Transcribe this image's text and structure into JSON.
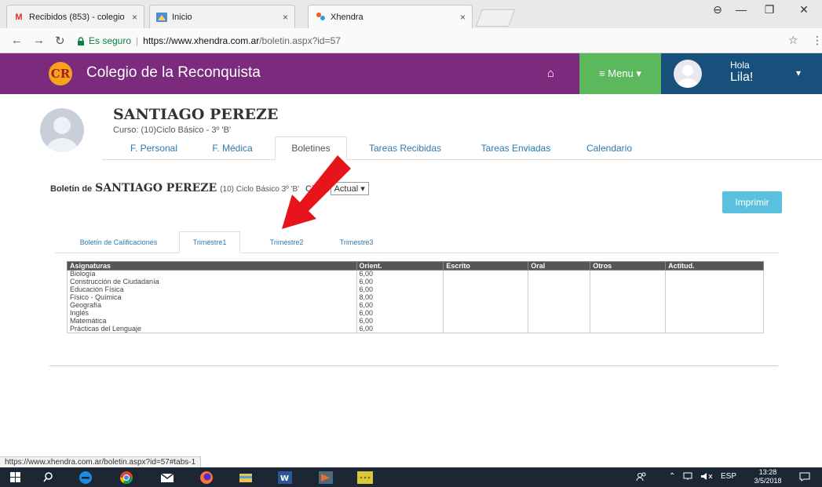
{
  "browser": {
    "tabs": [
      {
        "title": "Recibidos (853) - colegio",
        "icon": "gmail-icon"
      },
      {
        "title": "Inicio",
        "icon": "site-icon"
      },
      {
        "title": "Xhendra",
        "icon": "xhendra-icon"
      }
    ],
    "close_glyph": "×",
    "secure_label": "Es seguro",
    "url_host": "https://www.xhendra.com.ar",
    "url_path": "/boletin.aspx?id=57",
    "status_url": "https://www.xhendra.com.ar/boletin.aspx?id=57#tabs-1"
  },
  "header": {
    "logo_text": "CR",
    "title": "Colegio de la Reconquista",
    "menu_label": "≡ Menu ▾",
    "greeting": "Hola",
    "user_name": "Lila!"
  },
  "student": {
    "name": "SANTIAGO PEREZE",
    "course": "Curso: (10)Ciclo Básico - 3º 'B'"
  },
  "profile_tabs": [
    "F. Personal",
    "F. Médica",
    "Boletines",
    "Tareas Recibidas",
    "Tareas Enviadas",
    "Calendario"
  ],
  "boletin": {
    "label": "Boletin de",
    "student": "SANTIAGO PEREZE",
    "course": "(10) Ciclo Básico 3º 'B'",
    "ciclo_label": "Ciclo:",
    "ciclo_value": "Actual ▾",
    "print_label": "Imprimir"
  },
  "sub_tabs": [
    "Boletín de Calificaciones",
    "Trimestre1",
    "Trimestre2",
    "Trimestre3"
  ],
  "grades": {
    "columns": [
      "Asignaturas",
      "Orient.",
      "Escrito",
      "Oral",
      "Otros",
      "Actitud."
    ],
    "rows": [
      [
        "Biología",
        "6,00",
        "",
        "",
        "",
        ""
      ],
      [
        "Construcción de Ciudadanía",
        "6,00",
        "",
        "",
        "",
        ""
      ],
      [
        "Educación Física",
        "6,00",
        "",
        "",
        "",
        ""
      ],
      [
        "Físico - Química",
        "8,00",
        "",
        "",
        "",
        ""
      ],
      [
        "Geografía",
        "6,00",
        "",
        "",
        "",
        ""
      ],
      [
        "Inglés",
        "6,00",
        "",
        "",
        "",
        ""
      ],
      [
        "Matemática",
        "6,00",
        "",
        "",
        "",
        ""
      ],
      [
        "Prácticas del Lenguaje",
        "6,00",
        "",
        "",
        "",
        ""
      ]
    ]
  },
  "taskbar": {
    "lang": "ESP",
    "time": "13:28",
    "date": "3/5/2018"
  },
  "colors": {
    "header_purple": "#7b2a7e",
    "menu_green": "#5cb85c",
    "user_blue": "#17507a",
    "print_blue": "#5bc0de",
    "arrow_red": "#e8141c"
  }
}
